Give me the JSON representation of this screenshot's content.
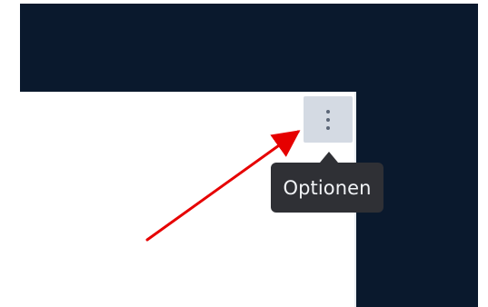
{
  "options_button": {
    "icon": "more-vertical-icon"
  },
  "tooltip": {
    "text": "Optionen"
  },
  "colors": {
    "dark_background": "#0a192d",
    "panel": "#ffffff",
    "button_bg": "#d4dae3",
    "button_icon": "#5b6677",
    "tooltip_bg": "#2f3035",
    "tooltip_text": "#f1f3f6",
    "annotation_arrow": "#e60000"
  }
}
